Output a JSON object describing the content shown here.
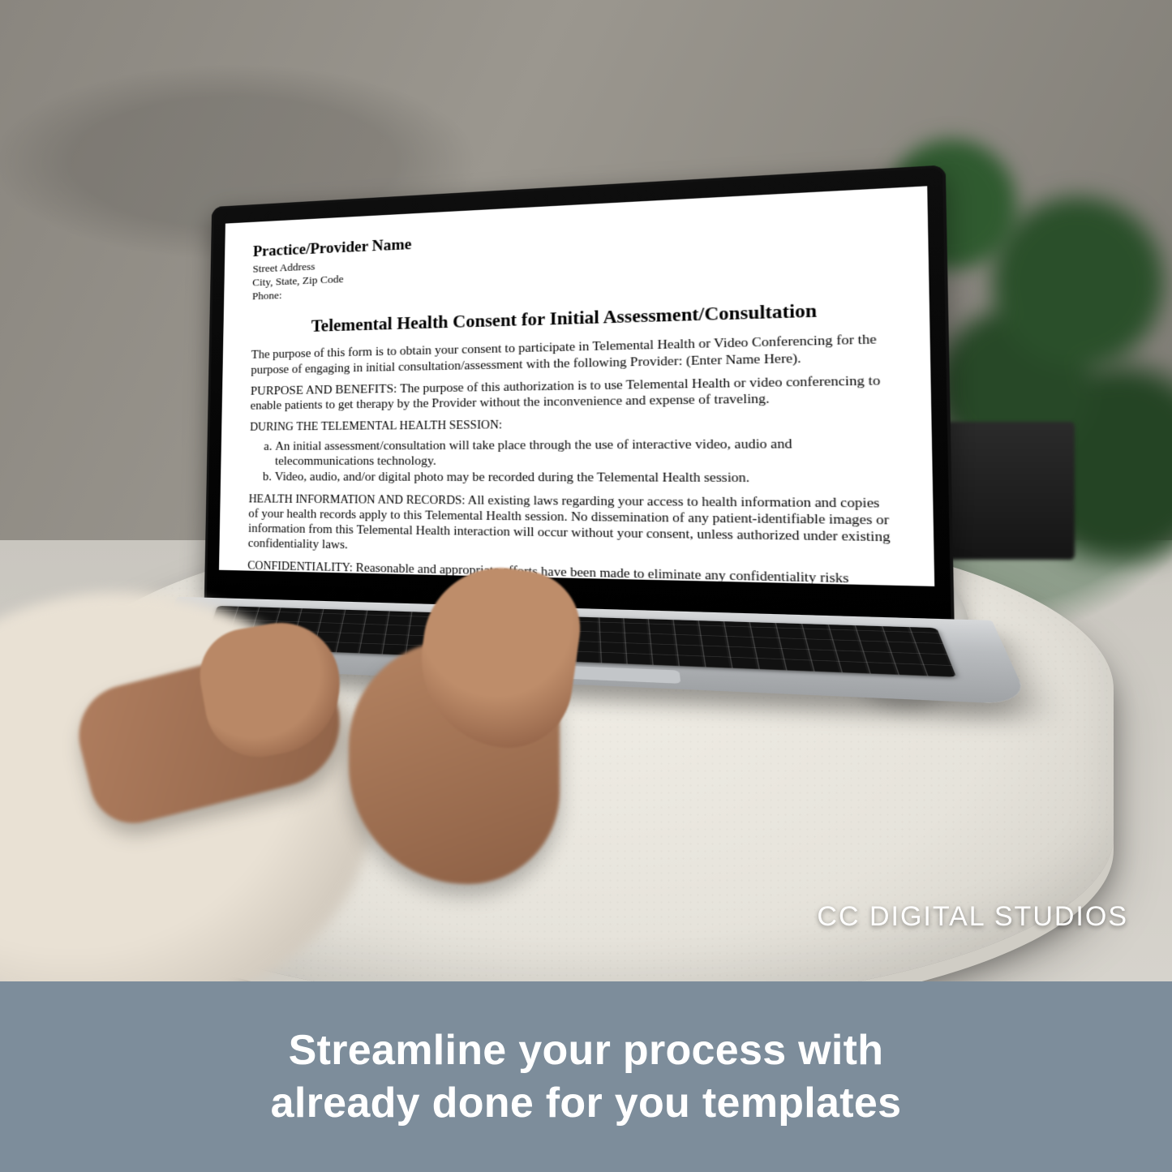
{
  "watermark": "CC DIGITAL STUDIOS",
  "caption": "Streamline your process with\nalready done for you templates",
  "document": {
    "provider_label": "Practice/Provider Name",
    "address_lines": [
      "Street Address",
      "City, State, Zip Code",
      "Phone:"
    ],
    "title": "Telemental Health Consent for Initial Assessment/Consultation",
    "intro": "The purpose of this form is to obtain your consent to participate in Telemental Health or Video Conferencing for the purpose of engaging in initial consultation/assessment with the following Provider: (Enter Name Here).",
    "purpose_label": "PURPOSE AND BENEFITS:",
    "purpose_text": "The purpose of this authorization is to use Telemental Health or video conferencing to enable patients to get therapy by the Provider without the inconvenience and expense of traveling.",
    "during_label": "DURING THE TELEMENTAL HEALTH SESSION:",
    "during_items": [
      "An initial assessment/consultation will take place through the use of interactive video, audio and telecommunications technology.",
      "Video, audio, and/or digital photo may be recorded during the Telemental Health session."
    ],
    "health_label": "HEALTH INFORMATION AND RECORDS:",
    "health_text": "All existing laws regarding your access to health information and copies of your health records apply to this Telemental Health session. No dissemination of any patient-identifiable images or information from this Telemental Health interaction will occur without your consent, unless authorized under existing confidentiality laws.",
    "conf_label": "CONFIDENTIALITY:",
    "conf_text": "Reasonable and appropriate efforts have been made to eliminate any confidentiality risks associated with the Telemental Health services. All existing confidentiality protections"
  }
}
